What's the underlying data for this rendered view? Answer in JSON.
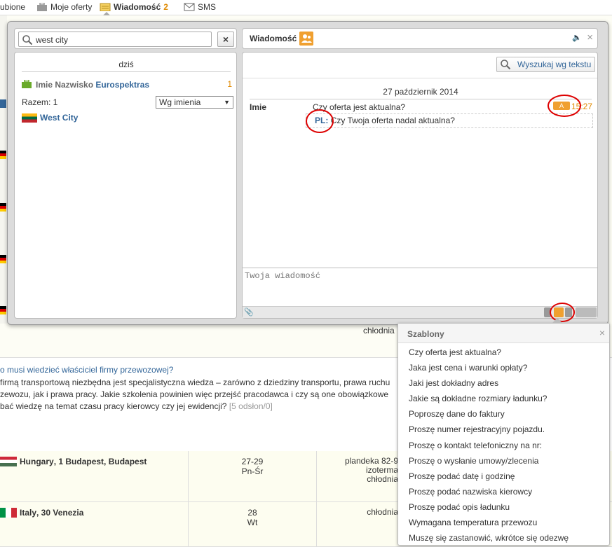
{
  "topbar": {
    "tabs": [
      {
        "label": "ubione"
      },
      {
        "label": "Moje oferty"
      },
      {
        "label": "Wiadomość",
        "count": "2"
      },
      {
        "label": "SMS"
      }
    ]
  },
  "search": {
    "value": "west city",
    "clear_label": "×"
  },
  "contacts": {
    "day_label": "dziś",
    "contact_name": "Imie Nazwisko",
    "contact_company": "Eurospektras",
    "unread": "1",
    "total_label": "Razem: 1",
    "sort_value": "Wg imienia",
    "company_name": "West City"
  },
  "chat": {
    "title": "Wiadomość",
    "close": "×",
    "search_text_label": "Wyszukaj wg tekstu",
    "date": "27 październik 2014",
    "sender": "Imie",
    "message": "Czy oferta jest aktualna?",
    "translate_label": "A",
    "time": "15:27",
    "translation_lang": "PL:",
    "translation": "Czy Twoja oferta nadal aktualna?",
    "compose_placeholder": "Twoja wiadomość"
  },
  "templates": {
    "title": "Szablony",
    "close": "×",
    "items": [
      "Czy oferta jest aktualna?",
      "Jaka jest cena i warunki opłaty?",
      "Jaki jest dokładny adres",
      "Jakie są dokładne rozmiary ładunku?",
      "Poproszę dane do faktury",
      "Proszę numer rejestracyjny pojazdu.",
      "Proszę o kontakt telefoniczny na nr:",
      "Proszę o wysłanie umowy/zlecenia",
      "Proszę podać datę i godzinę",
      "Proszę podać nazwiska kierowcy",
      "Proszę podać opis ładunku",
      "Wymagana temperatura przewozu",
      "Muszę się zastanowić, wkrótce się odezwę"
    ]
  },
  "background": {
    "truck_top": "chłodnia",
    "news_question": "o musi wiedzieć właściciel firmy przewozowej?",
    "news_line1": " firmą transportową niezbędna jest specjalistyczna wiedza – zarówno z dziedziny transportu, prawa ruchu",
    "news_line2": "zewozu, jak i prawa pracy. Jakie szkolenia powinien więc przejść pracodawca i czy są one obowiązkowe",
    "news_line3": "bać wiedzę na temat czasu pracy kierowcy czy jej ewidencji?",
    "news_views": "[5 odsłon/0]",
    "rows": [
      {
        "place": "Hungary",
        "city": ", 1 Budapest, Budapest",
        "date": "27-29",
        "day": "Pn-Śr",
        "truck": [
          "plandeka 82-9",
          "izoterma",
          "chłodnia"
        ]
      },
      {
        "place": "Italy",
        "city": ", 30 Venezia",
        "date": "28",
        "day": "Wt",
        "truck": [
          "chłodnia"
        ]
      }
    ]
  }
}
